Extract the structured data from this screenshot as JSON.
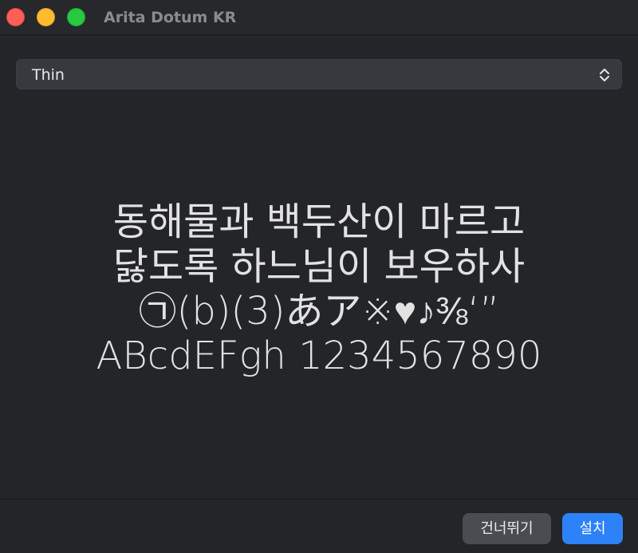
{
  "window": {
    "title": "Arita Dotum KR"
  },
  "style_select": {
    "selected": "Thin",
    "chevron_icon": "up-down-chevron-icon"
  },
  "preview": {
    "lines": [
      "동해물과 백두산이 마르고",
      "닳도록 하느님이 보우하사",
      "㉠(b)(3)あア※♥♪⅜‘”",
      "ABcdEFgh 1234567890"
    ]
  },
  "footer": {
    "skip_label": "건너뛰기",
    "install_label": "설치"
  },
  "colors": {
    "close": "#ff5f57",
    "minimize": "#febc2e",
    "zoom": "#28c840",
    "accent": "#2e82f7",
    "background": "#232529"
  }
}
